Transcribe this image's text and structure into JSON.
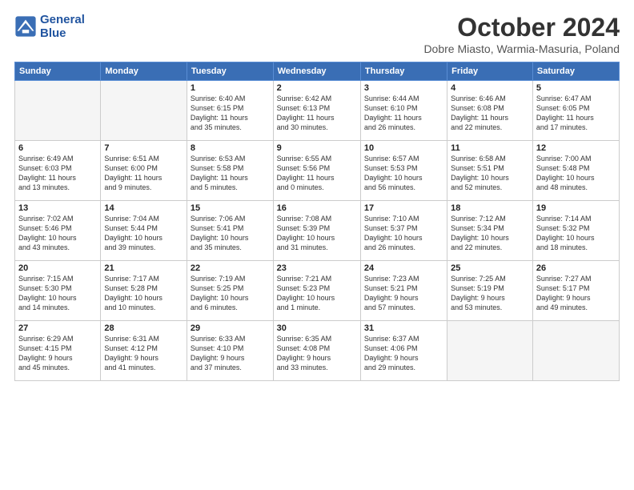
{
  "header": {
    "logo_line1": "General",
    "logo_line2": "Blue",
    "month": "October 2024",
    "location": "Dobre Miasto, Warmia-Masuria, Poland"
  },
  "weekdays": [
    "Sunday",
    "Monday",
    "Tuesday",
    "Wednesday",
    "Thursday",
    "Friday",
    "Saturday"
  ],
  "weeks": [
    [
      {
        "day": "",
        "info": ""
      },
      {
        "day": "",
        "info": ""
      },
      {
        "day": "1",
        "info": "Sunrise: 6:40 AM\nSunset: 6:15 PM\nDaylight: 11 hours\nand 35 minutes."
      },
      {
        "day": "2",
        "info": "Sunrise: 6:42 AM\nSunset: 6:13 PM\nDaylight: 11 hours\nand 30 minutes."
      },
      {
        "day": "3",
        "info": "Sunrise: 6:44 AM\nSunset: 6:10 PM\nDaylight: 11 hours\nand 26 minutes."
      },
      {
        "day": "4",
        "info": "Sunrise: 6:46 AM\nSunset: 6:08 PM\nDaylight: 11 hours\nand 22 minutes."
      },
      {
        "day": "5",
        "info": "Sunrise: 6:47 AM\nSunset: 6:05 PM\nDaylight: 11 hours\nand 17 minutes."
      }
    ],
    [
      {
        "day": "6",
        "info": "Sunrise: 6:49 AM\nSunset: 6:03 PM\nDaylight: 11 hours\nand 13 minutes."
      },
      {
        "day": "7",
        "info": "Sunrise: 6:51 AM\nSunset: 6:00 PM\nDaylight: 11 hours\nand 9 minutes."
      },
      {
        "day": "8",
        "info": "Sunrise: 6:53 AM\nSunset: 5:58 PM\nDaylight: 11 hours\nand 5 minutes."
      },
      {
        "day": "9",
        "info": "Sunrise: 6:55 AM\nSunset: 5:56 PM\nDaylight: 11 hours\nand 0 minutes."
      },
      {
        "day": "10",
        "info": "Sunrise: 6:57 AM\nSunset: 5:53 PM\nDaylight: 10 hours\nand 56 minutes."
      },
      {
        "day": "11",
        "info": "Sunrise: 6:58 AM\nSunset: 5:51 PM\nDaylight: 10 hours\nand 52 minutes."
      },
      {
        "day": "12",
        "info": "Sunrise: 7:00 AM\nSunset: 5:48 PM\nDaylight: 10 hours\nand 48 minutes."
      }
    ],
    [
      {
        "day": "13",
        "info": "Sunrise: 7:02 AM\nSunset: 5:46 PM\nDaylight: 10 hours\nand 43 minutes."
      },
      {
        "day": "14",
        "info": "Sunrise: 7:04 AM\nSunset: 5:44 PM\nDaylight: 10 hours\nand 39 minutes."
      },
      {
        "day": "15",
        "info": "Sunrise: 7:06 AM\nSunset: 5:41 PM\nDaylight: 10 hours\nand 35 minutes."
      },
      {
        "day": "16",
        "info": "Sunrise: 7:08 AM\nSunset: 5:39 PM\nDaylight: 10 hours\nand 31 minutes."
      },
      {
        "day": "17",
        "info": "Sunrise: 7:10 AM\nSunset: 5:37 PM\nDaylight: 10 hours\nand 26 minutes."
      },
      {
        "day": "18",
        "info": "Sunrise: 7:12 AM\nSunset: 5:34 PM\nDaylight: 10 hours\nand 22 minutes."
      },
      {
        "day": "19",
        "info": "Sunrise: 7:14 AM\nSunset: 5:32 PM\nDaylight: 10 hours\nand 18 minutes."
      }
    ],
    [
      {
        "day": "20",
        "info": "Sunrise: 7:15 AM\nSunset: 5:30 PM\nDaylight: 10 hours\nand 14 minutes."
      },
      {
        "day": "21",
        "info": "Sunrise: 7:17 AM\nSunset: 5:28 PM\nDaylight: 10 hours\nand 10 minutes."
      },
      {
        "day": "22",
        "info": "Sunrise: 7:19 AM\nSunset: 5:25 PM\nDaylight: 10 hours\nand 6 minutes."
      },
      {
        "day": "23",
        "info": "Sunrise: 7:21 AM\nSunset: 5:23 PM\nDaylight: 10 hours\nand 1 minute."
      },
      {
        "day": "24",
        "info": "Sunrise: 7:23 AM\nSunset: 5:21 PM\nDaylight: 9 hours\nand 57 minutes."
      },
      {
        "day": "25",
        "info": "Sunrise: 7:25 AM\nSunset: 5:19 PM\nDaylight: 9 hours\nand 53 minutes."
      },
      {
        "day": "26",
        "info": "Sunrise: 7:27 AM\nSunset: 5:17 PM\nDaylight: 9 hours\nand 49 minutes."
      }
    ],
    [
      {
        "day": "27",
        "info": "Sunrise: 6:29 AM\nSunset: 4:15 PM\nDaylight: 9 hours\nand 45 minutes."
      },
      {
        "day": "28",
        "info": "Sunrise: 6:31 AM\nSunset: 4:12 PM\nDaylight: 9 hours\nand 41 minutes."
      },
      {
        "day": "29",
        "info": "Sunrise: 6:33 AM\nSunset: 4:10 PM\nDaylight: 9 hours\nand 37 minutes."
      },
      {
        "day": "30",
        "info": "Sunrise: 6:35 AM\nSunset: 4:08 PM\nDaylight: 9 hours\nand 33 minutes."
      },
      {
        "day": "31",
        "info": "Sunrise: 6:37 AM\nSunset: 4:06 PM\nDaylight: 9 hours\nand 29 minutes."
      },
      {
        "day": "",
        "info": ""
      },
      {
        "day": "",
        "info": ""
      }
    ]
  ]
}
